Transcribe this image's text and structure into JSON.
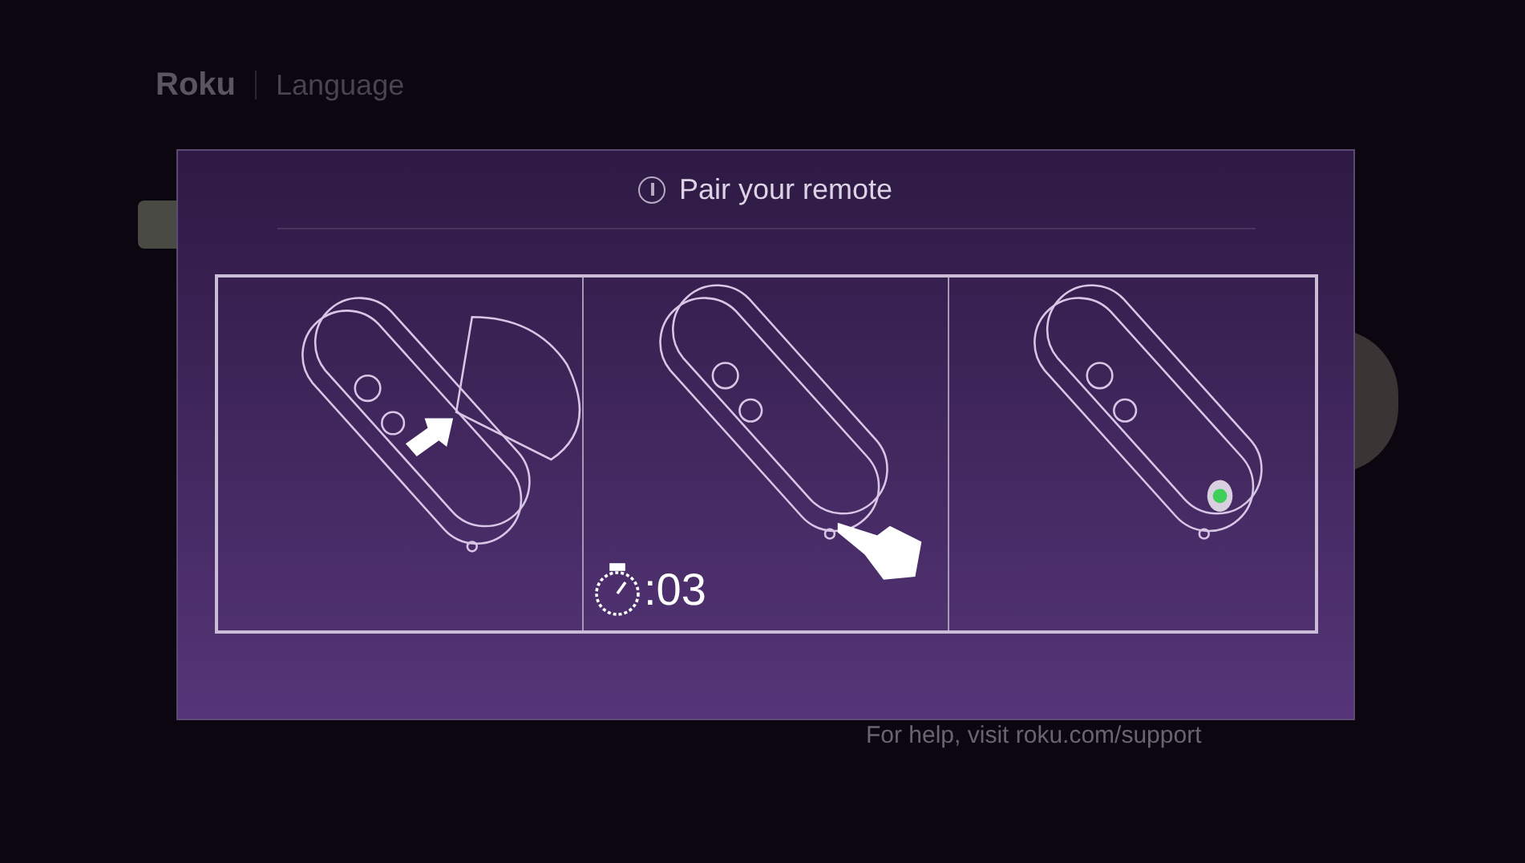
{
  "header": {
    "logo": "Roku",
    "title": "Language"
  },
  "dialog": {
    "title": "Pair your remote",
    "steps": [
      {
        "kind": "remove-cover"
      },
      {
        "kind": "press-button",
        "timer": ":03"
      },
      {
        "kind": "light"
      }
    ]
  },
  "help": "For help, visit roku.com/support"
}
